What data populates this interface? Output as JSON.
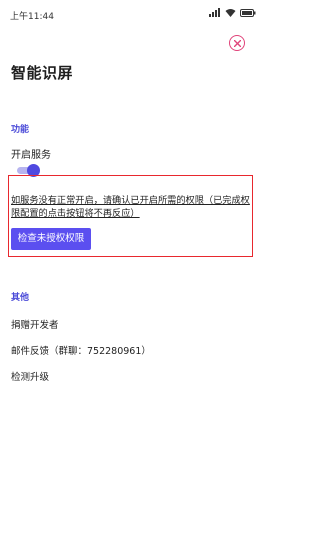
{
  "status_bar": {
    "time": "上午11:44"
  },
  "page": {
    "title": "智能识屏"
  },
  "sections": {
    "feature": {
      "header": "功能",
      "service_label": "开启服务",
      "service_enabled": true,
      "notice": "如服务没有正常开启，请确认已开启所需的权限（已完成权限配置的点击按钮将不再反应）",
      "check_button_label": "检查未授权权限"
    },
    "other": {
      "header": "其他",
      "items": [
        {
          "label": "捐赠开发者"
        },
        {
          "label": "邮件反馈（群聊：752280961）"
        },
        {
          "label": "检测升级"
        }
      ]
    }
  },
  "colors": {
    "accent": "#5b4ff0",
    "section_header": "#4a4ad8",
    "highlight_border": "#e8282e",
    "close_icon": "#e0447a"
  },
  "icons": {
    "close": "close-circle-icon",
    "signal": "signal-icon",
    "wifi": "wifi-icon",
    "battery": "battery-icon"
  }
}
